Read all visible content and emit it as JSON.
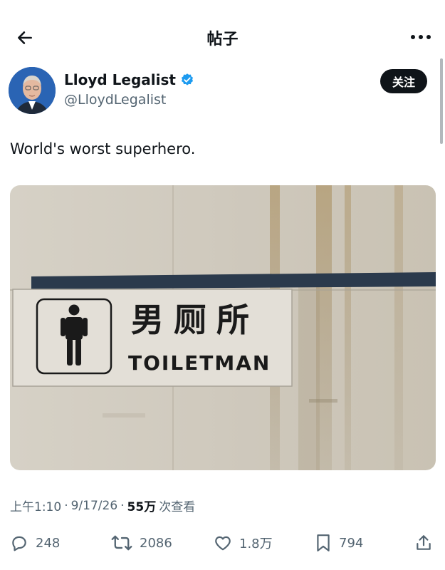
{
  "header": {
    "title": "帖子"
  },
  "author": {
    "name": "Lloyd Legalist",
    "handle": "@LloydLegalist",
    "verified": true,
    "follow_label": "关注"
  },
  "post": {
    "text": "World's worst superhero.",
    "image": {
      "sign_text_cn": "男厕所",
      "sign_text_en": "TOILETMAN"
    }
  },
  "meta": {
    "time": "上午1:10",
    "sep1": "·",
    "date": "9/17/26",
    "sep2": "·",
    "views_count": "55万",
    "views_label": "次查看"
  },
  "actions": {
    "replies": "248",
    "reposts": "2086",
    "likes": "1.8万",
    "bookmarks": "794"
  },
  "colors": {
    "verified": "#1d9bf0",
    "text": "#0f1419",
    "secondary": "#536471"
  }
}
